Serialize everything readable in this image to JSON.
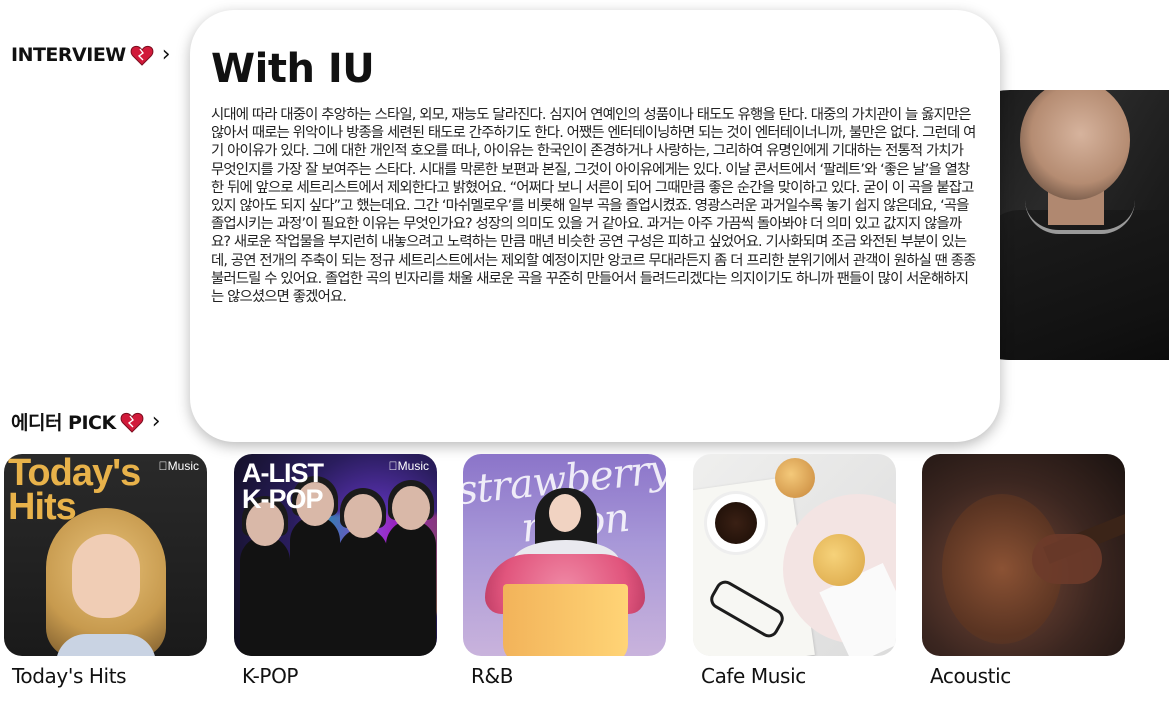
{
  "sections": {
    "interview": {
      "label": "INTERVIEW"
    },
    "pick": {
      "label": "에디터 PICK"
    }
  },
  "icons": {
    "heart": "heart-icon",
    "chevron": "chevron-right-icon",
    "heart_color": "#d11a3a"
  },
  "chevron_char": "›",
  "article": {
    "title": "With IU",
    "body": "시대에 따라 대중이 추앙하는 스타일, 외모, 재능도 달라진다. 심지어 연예인의 성품이나 태도도 유행을 탄다. 대중의 가치관이 늘 옳지만은 않아서 때로는 위악이나 방종을 세련된 태도로 간주하기도 한다. 어쨌든 엔터테이닝하면 되는 것이 엔터테이너니까, 불만은 없다. 그런데 여기 아이유가 있다. 그에 대한 개인적 호오를 떠나, 아이유는 한국인이 존경하거나 사랑하는, 그리하여 유명인에게 기대하는 전통적 가치가 무엇인지를 가장 잘 보여주는 스타다. 시대를 막론한 보편과 본질, 그것이 아이유에게는 있다. 이날 콘서트에서 ‘팔레트’와 ‘좋은 날’을 열창한 뒤에 앞으로 세트리스트에서 제외한다고 밝혔어요. “어쩌다 보니 서른이 되어 그때만큼 좋은 순간을 맞이하고 있다. 굳이 이 곡을 붙잡고 있지 않아도 되지 싶다”고 했는데요. 그간 ‘마쉬멜로우’를 비롯해 일부 곡을 졸업시켰죠. 영광스러운 과거일수록 놓기 쉽지 않은데요, ‘곡을 졸업시키는 과정’이 필요한 이유는 무엇인가요? 성장의 의미도 있을 거 같아요. 과거는 아주 가끔씩 돌아봐야 더 의미 있고 값지지 않을까요? 새로운 작업물을 부지런히 내놓으려고 노력하는 만큼 매년 비슷한 공연 구성은 피하고 싶었어요. 기사화되며 조금 와전된 부분이 있는데, 공연 전개의 주축이 되는 정규 세트리스트에서는 제외할 예정이지만 앙코르 무대라든지 좀 더 프리한 분위기에서 관객이 원하실 땐 종종 불러드릴 수 있어요. 졸업한 곡의 빈자리를 채울 새로운 곡을 꾸준히 만들어서 들려드리겠다는 의지이기도 하니까 팬들이 많이 서운해하지는 않으셨으면 좋겠어요."
  },
  "albums": [
    {
      "label": "Today's Hits",
      "cover_title_1": "Today's",
      "cover_title_2": "Hits",
      "badge": "Music"
    },
    {
      "label": "K-POP",
      "cover_title_1": "A-LIST",
      "cover_title_2": "K-POP",
      "badge": "Music"
    },
    {
      "label": "R&B",
      "cover_title_1": "strawberry",
      "cover_title_2": "moon"
    },
    {
      "label": "Cafe Music"
    },
    {
      "label": "Acoustic"
    }
  ]
}
